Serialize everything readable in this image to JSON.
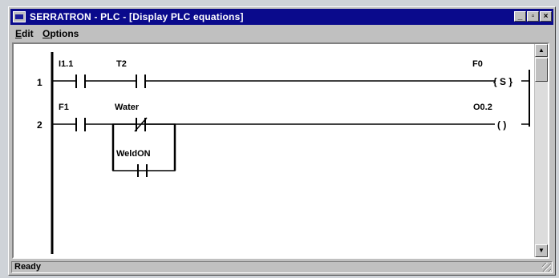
{
  "window": {
    "title": "SERRATRON - PLC - [Display PLC equations]",
    "controls": {
      "minimize": "_",
      "restore": "▫",
      "close": "×"
    }
  },
  "menu": {
    "items": [
      {
        "underline": "E",
        "rest": "dit"
      },
      {
        "underline": "O",
        "rest": "ptions"
      }
    ]
  },
  "ladder": {
    "rungs": [
      {
        "number": "1",
        "contacts": [
          "I1.1",
          "T2"
        ],
        "coil_label": "F0",
        "coil_symbol": "{ S }"
      },
      {
        "number": "2",
        "contacts": [
          "F1",
          "Water",
          "WeldON"
        ],
        "coil_label": "O0.2",
        "coil_symbol": "(   )"
      }
    ]
  },
  "status": {
    "text": "Ready"
  }
}
